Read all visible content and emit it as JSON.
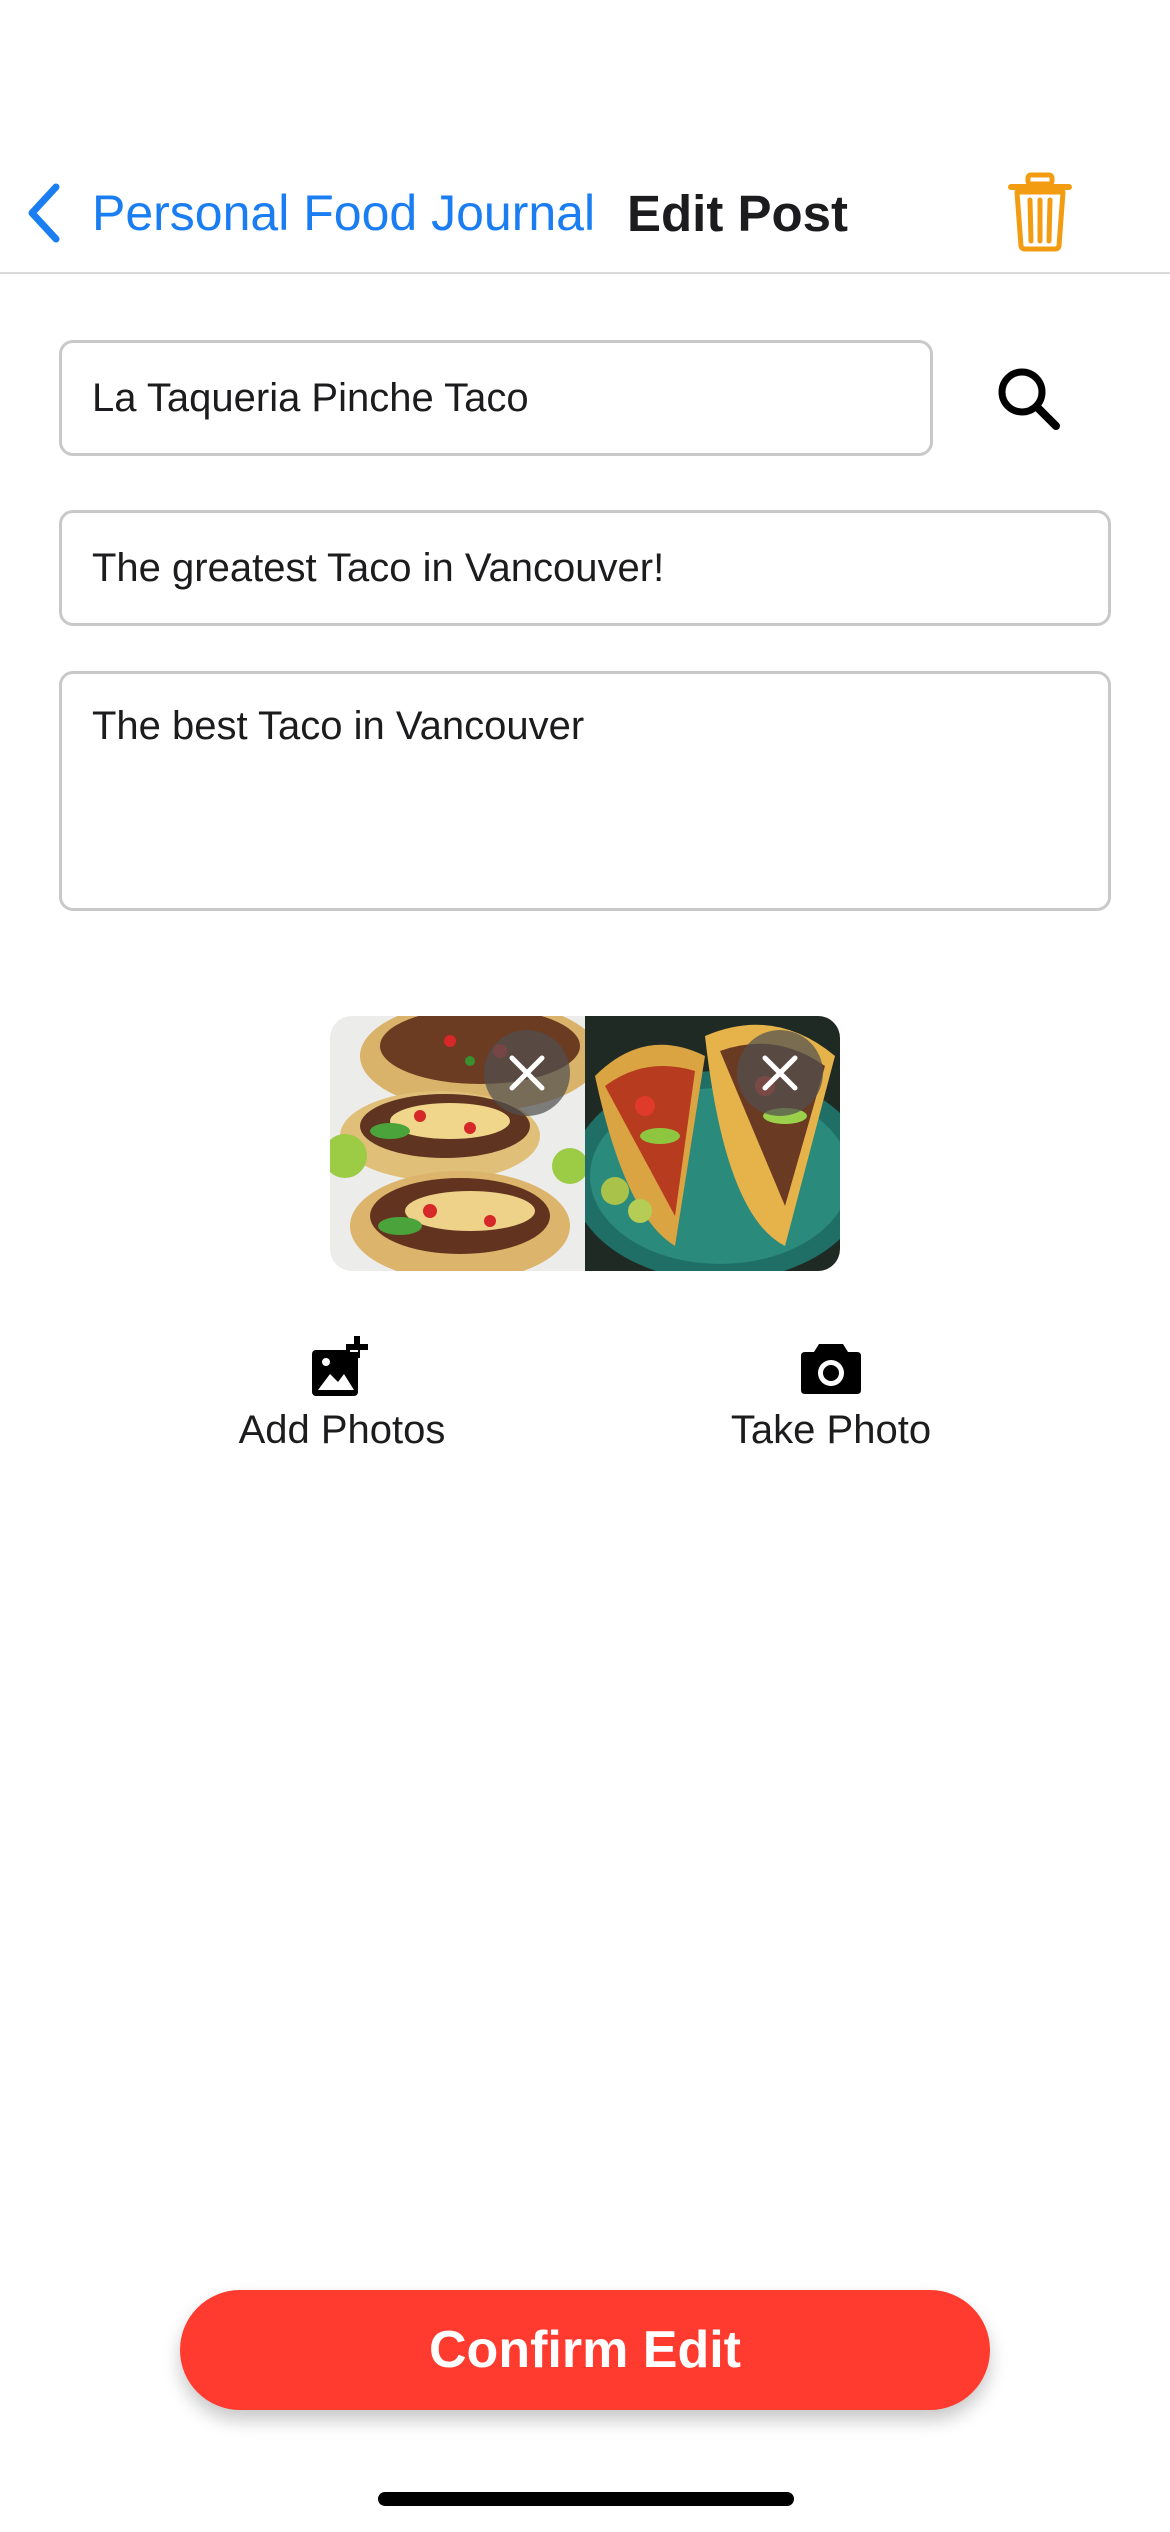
{
  "nav": {
    "back_label": "Personal Food Journal",
    "title": "Edit Post"
  },
  "form": {
    "place_value": "La Taqueria Pinche Taco",
    "title_value": "The greatest Taco in Vancouver!",
    "description_value": "The best Taco in Vancouver"
  },
  "photos": [
    {
      "icon": "photo-tacos-1"
    },
    {
      "icon": "photo-tacos-2"
    }
  ],
  "actions": {
    "add_photos_label": "Add Photos",
    "take_photo_label": "Take Photo"
  },
  "confirm_label": "Confirm Edit",
  "colors": {
    "accent_blue": "#1a7ef2",
    "delete_orange": "#f39c12",
    "confirm_red": "#ff3b30"
  }
}
